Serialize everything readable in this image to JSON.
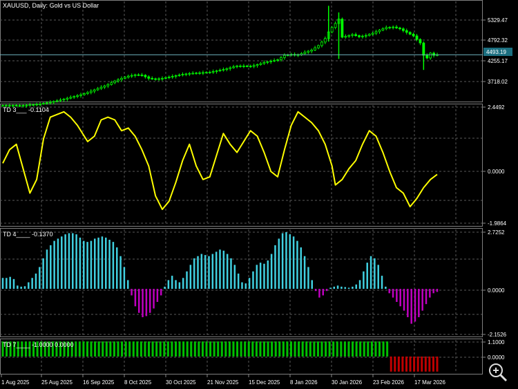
{
  "header": {
    "symbol": "XAUUSD",
    "period": "Daily",
    "description": "Gold vs US Dollar"
  },
  "chart_data": [
    {
      "type": "candlestick",
      "pane": "main",
      "current_price": "4493.19",
      "y_ticks": [
        "5329.47",
        "4792.32",
        "4255.17",
        "3718.02"
      ],
      "ylim": [
        3450,
        5700
      ],
      "price_path": [
        [
          0,
          3345
        ],
        [
          3,
          3350
        ],
        [
          5,
          3340
        ],
        [
          8,
          3360
        ],
        [
          11,
          3380
        ],
        [
          14,
          3420
        ],
        [
          17,
          3470
        ],
        [
          20,
          3530
        ],
        [
          23,
          3590
        ],
        [
          25,
          3640
        ],
        [
          27,
          3700
        ],
        [
          29,
          3760
        ],
        [
          31,
          3820
        ],
        [
          33,
          3900
        ],
        [
          35,
          3960
        ],
        [
          37,
          4010
        ],
        [
          39,
          4040
        ],
        [
          41,
          4030
        ],
        [
          43,
          3960
        ],
        [
          45,
          3940
        ],
        [
          47,
          3960
        ],
        [
          49,
          3990
        ],
        [
          51,
          4020
        ],
        [
          53,
          4050
        ],
        [
          55,
          4070
        ],
        [
          57,
          4080
        ],
        [
          59,
          4090
        ],
        [
          61,
          4100
        ],
        [
          63,
          4130
        ],
        [
          65,
          4160
        ],
        [
          67,
          4200
        ],
        [
          69,
          4240
        ],
        [
          71,
          4240
        ],
        [
          73,
          4230
        ],
        [
          75,
          4270
        ],
        [
          77,
          4320
        ],
        [
          79,
          4350
        ],
        [
          81,
          4380
        ],
        [
          83,
          4480
        ],
        [
          85,
          4500
        ],
        [
          87,
          4490
        ],
        [
          89,
          4550
        ],
        [
          91,
          4600
        ],
        [
          93,
          4700
        ],
        [
          95,
          4860
        ],
        [
          96,
          5010
        ],
        [
          97,
          5110
        ],
        [
          98,
          5200
        ],
        [
          99,
          5300
        ],
        [
          100,
          4890
        ],
        [
          101,
          4910
        ],
        [
          103,
          4950
        ],
        [
          105,
          4900
        ],
        [
          107,
          4930
        ],
        [
          109,
          4980
        ],
        [
          111,
          5050
        ],
        [
          113,
          5110
        ],
        [
          115,
          5120
        ],
        [
          117,
          5080
        ],
        [
          119,
          5000
        ],
        [
          121,
          4920
        ],
        [
          123,
          4760
        ],
        [
          124,
          4480
        ],
        [
          125,
          4420
        ],
        [
          126,
          4530
        ],
        [
          127,
          4480
        ],
        [
          128,
          4493
        ]
      ],
      "wick_spikes": [
        {
          "x": 96,
          "high": 5600,
          "low": 4790
        },
        {
          "x": 99,
          "high": 5450,
          "low": 4400
        },
        {
          "x": 124,
          "high": 4600,
          "low": 4150
        }
      ]
    },
    {
      "type": "line",
      "pane": "td3",
      "title": "TD 3___",
      "last_value": "-0.1104",
      "color": "#ffff00",
      "y_ticks": [
        "2.4492",
        "0.0000",
        "-1.9864"
      ],
      "ylim": [
        -1.9864,
        2.4492
      ],
      "points": [
        [
          0,
          0.3
        ],
        [
          2,
          0.8
        ],
        [
          4,
          1.0
        ],
        [
          6,
          0.1
        ],
        [
          8,
          -0.8
        ],
        [
          10,
          -0.3
        ],
        [
          12,
          1.2
        ],
        [
          14,
          2.0
        ],
        [
          16,
          2.1
        ],
        [
          18,
          2.2
        ],
        [
          20,
          2.0
        ],
        [
          22,
          1.7
        ],
        [
          25,
          1.1
        ],
        [
          27,
          1.3
        ],
        [
          29,
          1.9
        ],
        [
          31,
          2.0
        ],
        [
          33,
          1.9
        ],
        [
          35,
          1.5
        ],
        [
          37,
          1.6
        ],
        [
          39,
          1.3
        ],
        [
          41,
          0.8
        ],
        [
          43,
          0.2
        ],
        [
          45,
          -0.9
        ],
        [
          47,
          -1.4
        ],
        [
          49,
          -1.1
        ],
        [
          51,
          -0.4
        ],
        [
          53,
          0.4
        ],
        [
          55,
          1.0
        ],
        [
          57,
          0.2
        ],
        [
          59,
          -0.3
        ],
        [
          61,
          -0.2
        ],
        [
          63,
          0.6
        ],
        [
          65,
          1.4
        ],
        [
          67,
          1.0
        ],
        [
          69,
          0.7
        ],
        [
          71,
          1.1
        ],
        [
          73,
          1.5
        ],
        [
          75,
          1.3
        ],
        [
          77,
          0.7
        ],
        [
          79,
          0.0
        ],
        [
          81,
          -0.2
        ],
        [
          83,
          0.8
        ],
        [
          85,
          1.7
        ],
        [
          87,
          2.2
        ],
        [
          89,
          2.0
        ],
        [
          91,
          1.8
        ],
        [
          93,
          1.5
        ],
        [
          95,
          1.0
        ],
        [
          97,
          0.2
        ],
        [
          98,
          -0.5
        ],
        [
          100,
          -0.3
        ],
        [
          102,
          0.1
        ],
        [
          104,
          0.4
        ],
        [
          106,
          1.0
        ],
        [
          108,
          1.5
        ],
        [
          110,
          1.3
        ],
        [
          112,
          0.7
        ],
        [
          114,
          0.0
        ],
        [
          116,
          -0.6
        ],
        [
          118,
          -0.8
        ],
        [
          120,
          -1.3
        ],
        [
          122,
          -1.0
        ],
        [
          124,
          -0.6
        ],
        [
          126,
          -0.3
        ],
        [
          128,
          -0.11
        ]
      ]
    },
    {
      "type": "histogram",
      "pane": "td4",
      "title": "TD 4____",
      "last_value": "-0.1370",
      "positive_color": "#40d0e0",
      "negative_color": "#c000c0",
      "y_ticks": [
        "2.7252",
        "0.0000",
        "-2.1526"
      ],
      "ylim": [
        -2.1526,
        2.7252
      ],
      "values": [
        0.5,
        0.5,
        0.55,
        0.45,
        0.15,
        0.1,
        0.12,
        0.3,
        0.5,
        0.7,
        1.0,
        1.4,
        1.8,
        2.0,
        2.2,
        2.3,
        2.4,
        2.5,
        2.55,
        2.55,
        2.5,
        2.35,
        2.2,
        2.15,
        2.2,
        2.3,
        2.35,
        2.4,
        2.35,
        2.25,
        2.15,
        1.9,
        1.5,
        1.0,
        0.4,
        -0.3,
        -0.8,
        -1.1,
        -1.3,
        -1.25,
        -1.1,
        -0.9,
        -0.6,
        -0.3,
        0.1,
        0.4,
        0.6,
        0.4,
        0.3,
        0.5,
        0.8,
        1.1,
        1.4,
        1.5,
        1.6,
        1.55,
        1.5,
        1.6,
        1.7,
        1.8,
        1.75,
        1.6,
        1.4,
        1.1,
        0.7,
        0.3,
        0.25,
        0.5,
        0.8,
        1.1,
        1.2,
        1.15,
        1.3,
        1.6,
        2.0,
        2.3,
        2.55,
        2.6,
        2.5,
        2.4,
        2.2,
        1.9,
        1.5,
        1.0,
        0.4,
        -0.1,
        -0.4,
        -0.3,
        -0.1,
        0.05,
        0.1,
        0.15,
        0.1,
        0.08,
        0.05,
        0.1,
        0.2,
        0.4,
        0.8,
        1.2,
        1.5,
        1.4,
        1.1,
        0.6,
        0.1,
        -0.2,
        -0.4,
        -0.6,
        -0.8,
        -1.0,
        -1.3,
        -1.6,
        -1.5,
        -1.3,
        -1.0,
        -0.7,
        -0.4,
        -0.2,
        -0.14
      ]
    },
    {
      "type": "histogram",
      "pane": "td7",
      "title": "TD 7____",
      "last_value": "-1.0000 0.0000",
      "positive_color": "#00c000",
      "negative_color": "#c00000",
      "y_ticks": [
        "1.1000",
        "0.0000"
      ],
      "ylim": [
        -1.1,
        1.1
      ],
      "switch_index": 101,
      "total_bars": 114
    }
  ],
  "x_axis": {
    "labels": [
      "1 Aug 2025",
      "25 Aug 2025",
      "16 Sep 2025",
      "8 Oct 2025",
      "30 Oct 2025",
      "21 Nov 2025",
      "15 Dec 2025",
      "8 Jan 2026",
      "30 Jan 2026",
      "23 Feb 2026",
      "17 Mar 2026"
    ]
  },
  "icons": {
    "zoom": "magnifier-plus-icon"
  }
}
